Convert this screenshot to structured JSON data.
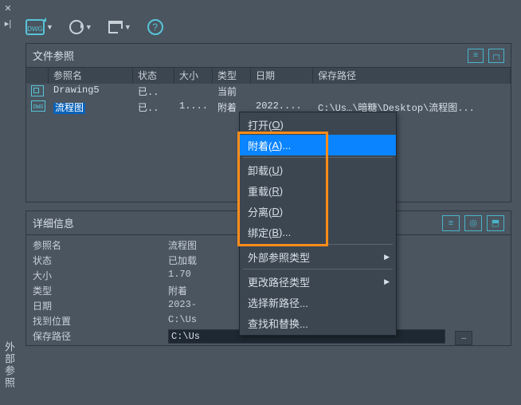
{
  "sidebar": {
    "label": "外部参照"
  },
  "toolbar": {
    "dwg": "DWG",
    "help": "?"
  },
  "panel_top": {
    "title": "文件参照",
    "cols": {
      "name": "参照名",
      "stat": "状态",
      "size": "大小",
      "type": "类型",
      "date": "日期",
      "path": "保存路径"
    },
    "rows": [
      {
        "name": "Drawing5",
        "stat": "已..",
        "size": "",
        "type": "当前",
        "date": "",
        "path": ""
      },
      {
        "name": "流程图",
        "stat": "已..",
        "size": "1....",
        "type": "附着",
        "date": "2022....",
        "path": "C:\\Us…\\暗糖\\Desktop\\流程图..."
      }
    ]
  },
  "panel_bot": {
    "title": "详细信息",
    "rows": {
      "name_k": "参照名",
      "name_v": "流程图",
      "stat_k": "状态",
      "stat_v": "已加载",
      "size_k": "大小",
      "size_v": "1.70",
      "type_k": "类型",
      "type_v": "附着",
      "date_k": "日期",
      "date_v": "2023-",
      "found_k": "找到位置",
      "found_v": "C:\\Us",
      "save_k": "保存路径",
      "save_v": "C:\\Us"
    }
  },
  "ctx": {
    "open": "打开(",
    "open_u": "O",
    "open_e": ")",
    "attach": "附着(",
    "attach_u": "A",
    "attach_e": ")...",
    "unload": "卸载(",
    "unload_u": "U",
    "unload_e": ")",
    "reload": "重载(",
    "reload_u": "R",
    "reload_e": ")",
    "detach": "分离(",
    "detach_u": "D",
    "detach_e": ")",
    "bind": "绑定(",
    "bind_u": "B",
    "bind_e": ")...",
    "ext_type": "外部参照类型",
    "path_type": "更改路径类型",
    "sel_path": "选择新路径...",
    "find_rep": "查找和替换..."
  }
}
